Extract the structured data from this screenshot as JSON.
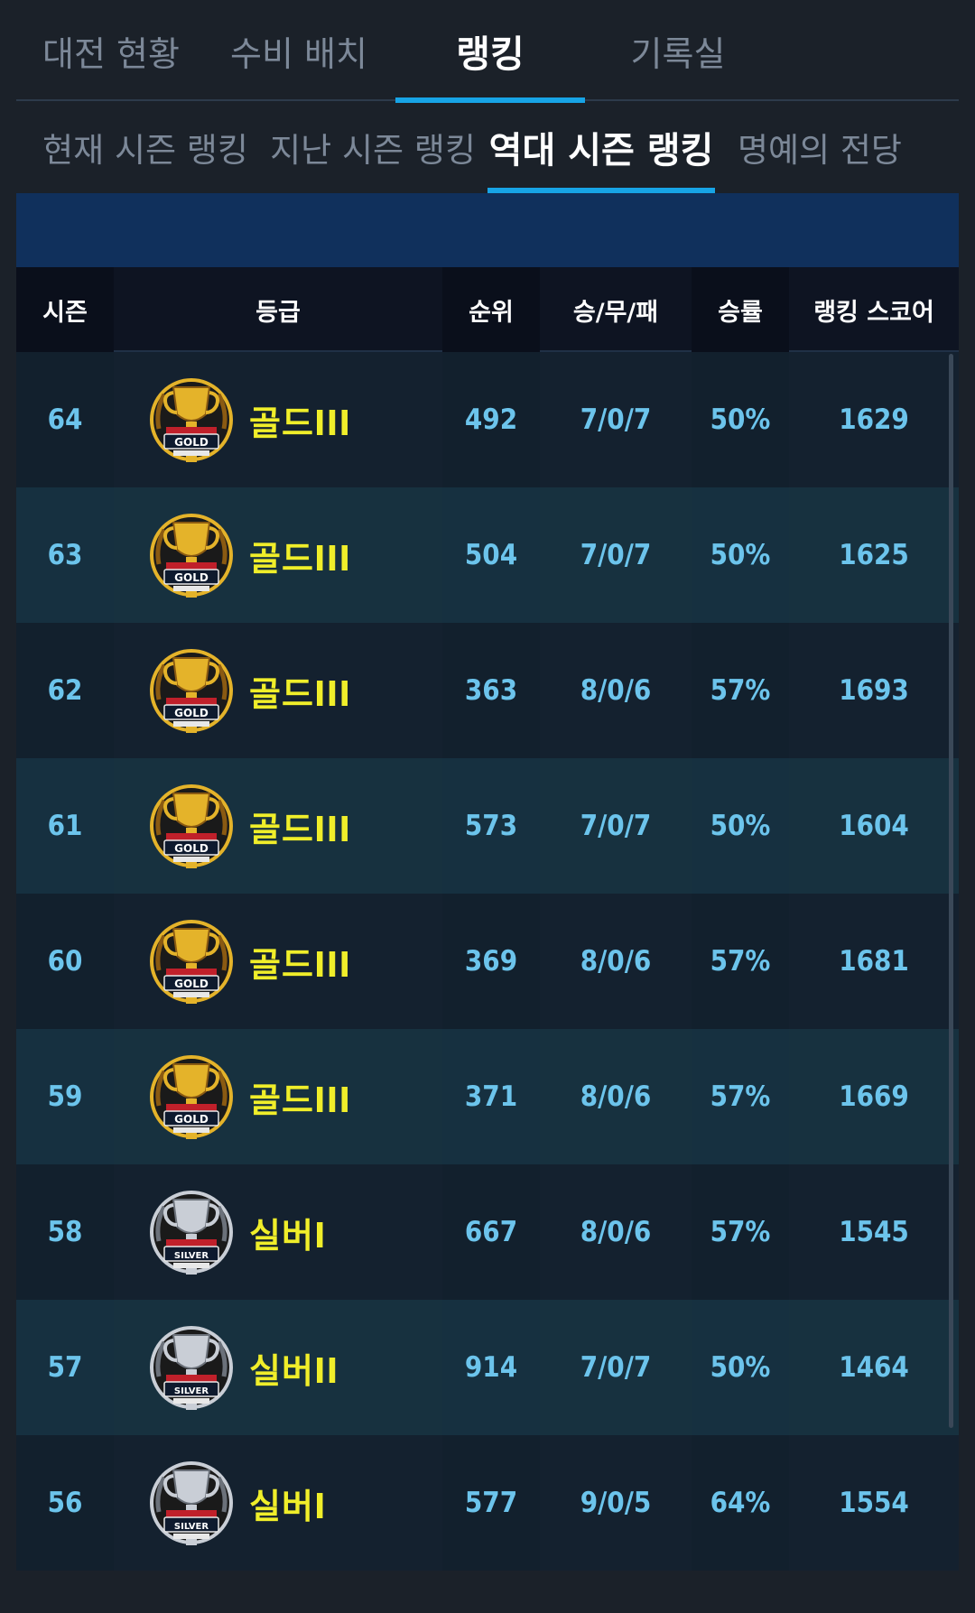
{
  "top_tabs": [
    "대전 현황",
    "수비 배치",
    "랭킹",
    "기록실"
  ],
  "top_active_index": 2,
  "sub_tabs": [
    "현재 시즌 랭킹",
    "지난 시즌 랭킹",
    "역대 시즌 랭킹",
    "명예의 전당"
  ],
  "sub_active_index": 2,
  "table": {
    "headers": {
      "season": "시즌",
      "grade": "등급",
      "rank": "순위",
      "wdl": "승/무/패",
      "win_rate": "승률",
      "score": "랭킹 스코어"
    },
    "rows": [
      {
        "season": "64",
        "badge": "gold-trophy-icon",
        "badge_text": "GOLD",
        "grade": "골드III",
        "rank": "492",
        "wdl": "7/0/7",
        "win_rate": "50%",
        "score": "1629"
      },
      {
        "season": "63",
        "badge": "gold-trophy-icon",
        "badge_text": "GOLD",
        "grade": "골드III",
        "rank": "504",
        "wdl": "7/0/7",
        "win_rate": "50%",
        "score": "1625"
      },
      {
        "season": "62",
        "badge": "gold-trophy-icon",
        "badge_text": "GOLD",
        "grade": "골드III",
        "rank": "363",
        "wdl": "8/0/6",
        "win_rate": "57%",
        "score": "1693"
      },
      {
        "season": "61",
        "badge": "gold-trophy-icon",
        "badge_text": "GOLD",
        "grade": "골드III",
        "rank": "573",
        "wdl": "7/0/7",
        "win_rate": "50%",
        "score": "1604"
      },
      {
        "season": "60",
        "badge": "gold-trophy-icon",
        "badge_text": "GOLD",
        "grade": "골드III",
        "rank": "369",
        "wdl": "8/0/6",
        "win_rate": "57%",
        "score": "1681"
      },
      {
        "season": "59",
        "badge": "gold-trophy-icon",
        "badge_text": "GOLD",
        "grade": "골드III",
        "rank": "371",
        "wdl": "8/0/6",
        "win_rate": "57%",
        "score": "1669"
      },
      {
        "season": "58",
        "badge": "silver-trophy-icon",
        "badge_text": "SILVER",
        "grade": "실버I",
        "rank": "667",
        "wdl": "8/0/6",
        "win_rate": "57%",
        "score": "1545"
      },
      {
        "season": "57",
        "badge": "silver-trophy-icon",
        "badge_text": "SILVER",
        "grade": "실버II",
        "rank": "914",
        "wdl": "7/0/7",
        "win_rate": "50%",
        "score": "1464"
      },
      {
        "season": "56",
        "badge": "silver-trophy-icon",
        "badge_text": "SILVER",
        "grade": "실버I",
        "rank": "577",
        "wdl": "9/0/5",
        "win_rate": "64%",
        "score": "1554"
      }
    ]
  },
  "colors": {
    "accent": "#17a4e6",
    "value_text": "#6cc4ec",
    "grade_text": "#f0ee2a",
    "banner": "#10305c",
    "gold": "#e4b32a",
    "silver": "#c9ced6"
  }
}
